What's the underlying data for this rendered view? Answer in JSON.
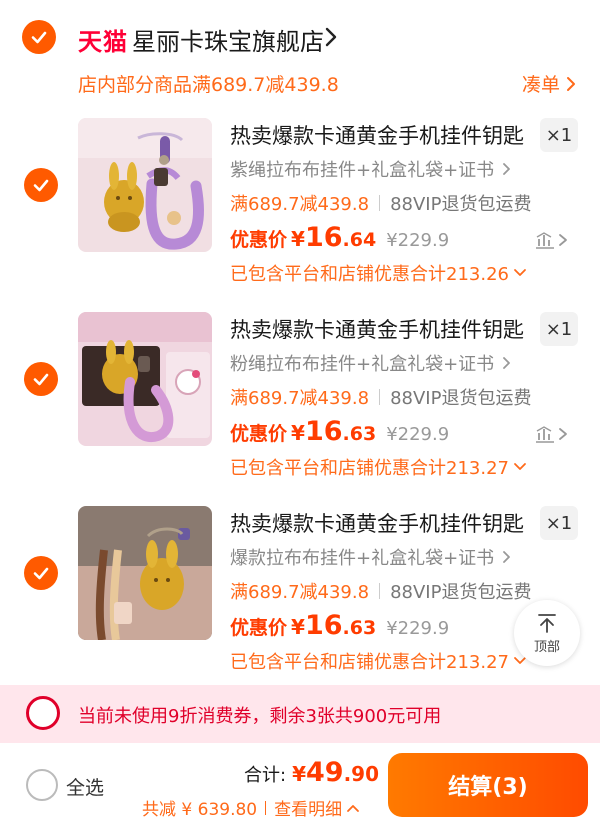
{
  "store": {
    "logo_text": "天猫",
    "name": "星丽卡珠宝旗舰店",
    "promo": "店内部分商品满689.7减439.8",
    "add_on_label": "凑单"
  },
  "items": [
    {
      "title": "热卖爆款卡通黄金手机挂件钥匙",
      "qty": "×1",
      "variant": "紫绳拉布布挂件+礼盒礼袋+证书",
      "promo": "满689.7减439.8",
      "return_tag": "88VIP退货包运费",
      "price_label": "优惠价",
      "currency": "¥",
      "price_int": "16",
      "price_dec": ".64",
      "original_price": "¥229.9",
      "discount_note": "已包含平台和店铺优惠合计213.26"
    },
    {
      "title": "热卖爆款卡通黄金手机挂件钥匙",
      "qty": "×1",
      "variant": "粉绳拉布布挂件+礼盒礼袋+证书",
      "promo": "满689.7减439.8",
      "return_tag": "88VIP退货包运费",
      "price_label": "优惠价",
      "currency": "¥",
      "price_int": "16",
      "price_dec": ".63",
      "original_price": "¥229.9",
      "discount_note": "已包含平台和店铺优惠合计213.27"
    },
    {
      "title": "热卖爆款卡通黄金手机挂件钥匙",
      "qty": "×1",
      "variant": "爆款拉布布挂件+礼盒礼袋+证书",
      "promo": "满689.7减439.8",
      "return_tag": "88VIP退货包运费",
      "price_label": "优惠价",
      "currency": "¥",
      "price_int": "16",
      "price_dec": ".63",
      "original_price": "¥229.9",
      "discount_note": "已包含平台和店铺优惠合计213.27"
    }
  ],
  "to_top_label": "顶部",
  "coupon_notice": "当前未使用9折消费券，剩余3张共900元可用",
  "footer": {
    "select_all_label": "全选",
    "total_label": "合计:",
    "total_currency": "¥",
    "total_int": "49",
    "total_dec": ".90",
    "saved_text": "共减 ¥ 639.80",
    "details_label": "查看明细",
    "checkout_label": "结算(3)"
  },
  "colors": {
    "accent": "#ff5a00",
    "price": "#ff3c00",
    "tmall_red": "#ff0036",
    "coupon_bg": "#ffe6ec"
  }
}
